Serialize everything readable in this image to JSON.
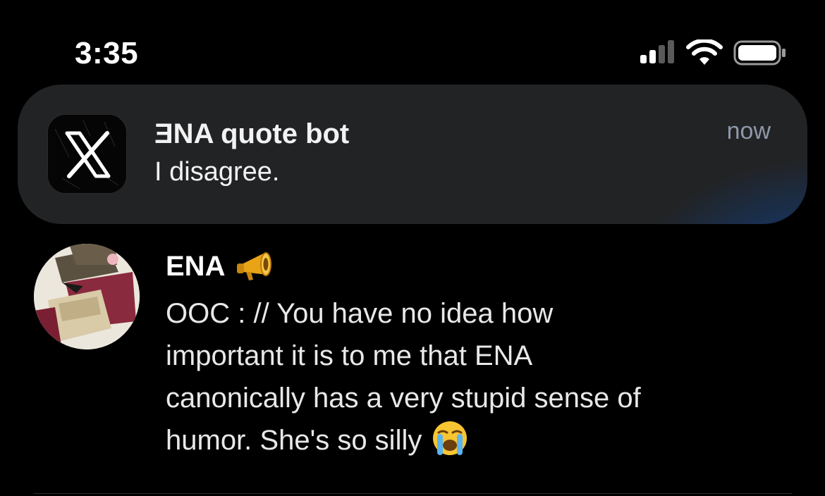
{
  "status_bar": {
    "time": "3:35",
    "icons": [
      "signal-icon",
      "wifi-icon",
      "battery-icon"
    ]
  },
  "notification": {
    "app_icon": "x-logo-icon",
    "title": "ƎNA quote bot",
    "body": "I disagree.",
    "time": "now"
  },
  "post": {
    "author": "ENA",
    "author_badge_icon": "megaphone-icon",
    "lines": [
      "OOC : // You have no idea how",
      "important it is to me that ENA",
      "canonically has a very stupid sense of",
      "humor. She's so silly"
    ],
    "trailing_emoji_icon": "loudly-crying-face-icon"
  },
  "colors": {
    "background": "#000000",
    "banner": "#222325",
    "banner_glow": "#124ea0",
    "secondary_text": "#8d98a8"
  }
}
